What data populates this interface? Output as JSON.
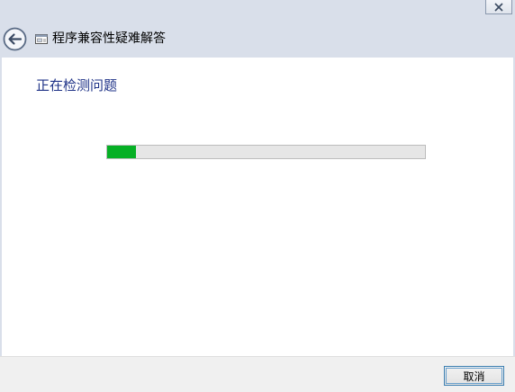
{
  "window": {
    "title": "程序兼容性疑难解答"
  },
  "content": {
    "status_heading": "正在检测问题",
    "progress": 0.09
  },
  "footer": {
    "cancel_label": "取消"
  },
  "colors": {
    "progress_fill": "#06b025",
    "heading_text": "#1e3287"
  },
  "icons": {
    "back": "back-arrow-icon",
    "app": "troubleshooter-icon",
    "close": "close-icon"
  }
}
